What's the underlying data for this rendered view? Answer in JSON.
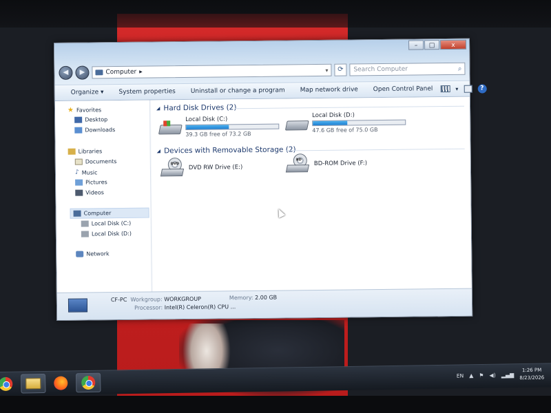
{
  "window": {
    "address": "Computer",
    "search_placeholder": "Search Computer",
    "caption_buttons": {
      "minimize": "–",
      "maximize": "□",
      "close": "x"
    }
  },
  "toolbar": {
    "organize": "Organize ▾",
    "system_properties": "System properties",
    "uninstall": "Uninstall or change a program",
    "map_drive": "Map network drive",
    "control_panel": "Open Control Panel"
  },
  "nav": {
    "favorites": "Favorites",
    "desktop": "Desktop",
    "downloads": "Downloads",
    "libraries": "Libraries",
    "documents": "Documents",
    "music": "Music",
    "pictures": "Pictures",
    "videos": "Videos",
    "computer": "Computer",
    "disk_c": "Local Disk (C:)",
    "disk_d": "Local Disk (D:)",
    "network": "Network"
  },
  "content": {
    "hard_disk_header": "Hard Disk Drives (2)",
    "removable_header": "Devices with Removable Storage (2)",
    "drives": [
      {
        "name": "Local Disk (C:)",
        "free": "39.3 GB free of 73.2 GB",
        "used_fraction": 0.46
      },
      {
        "name": "Local Disk (D:)",
        "free": "47.6 GB free of 75.0 GB",
        "used_fraction": 0.37
      }
    ],
    "removable": [
      {
        "name": "DVD RW Drive (E:)",
        "badge": "DVD"
      },
      {
        "name": "BD-ROM Drive (F:)",
        "badge": "BD"
      }
    ]
  },
  "details": {
    "computer_name": "CF-PC",
    "workgroup_label": "Workgroup:",
    "workgroup": "WORKGROUP",
    "memory_label": "Memory:",
    "memory": "2.00 GB",
    "processor_label": "Processor:",
    "processor": "Intel(R) Celeron(R) CPU ..."
  },
  "taskbar": {
    "language": "EN",
    "time": "1:26 PM",
    "date": "8/23/2026"
  },
  "icons": [
    "chrome-icon",
    "folder-icon",
    "firefox-icon",
    "search-icon",
    "help-icon"
  ]
}
